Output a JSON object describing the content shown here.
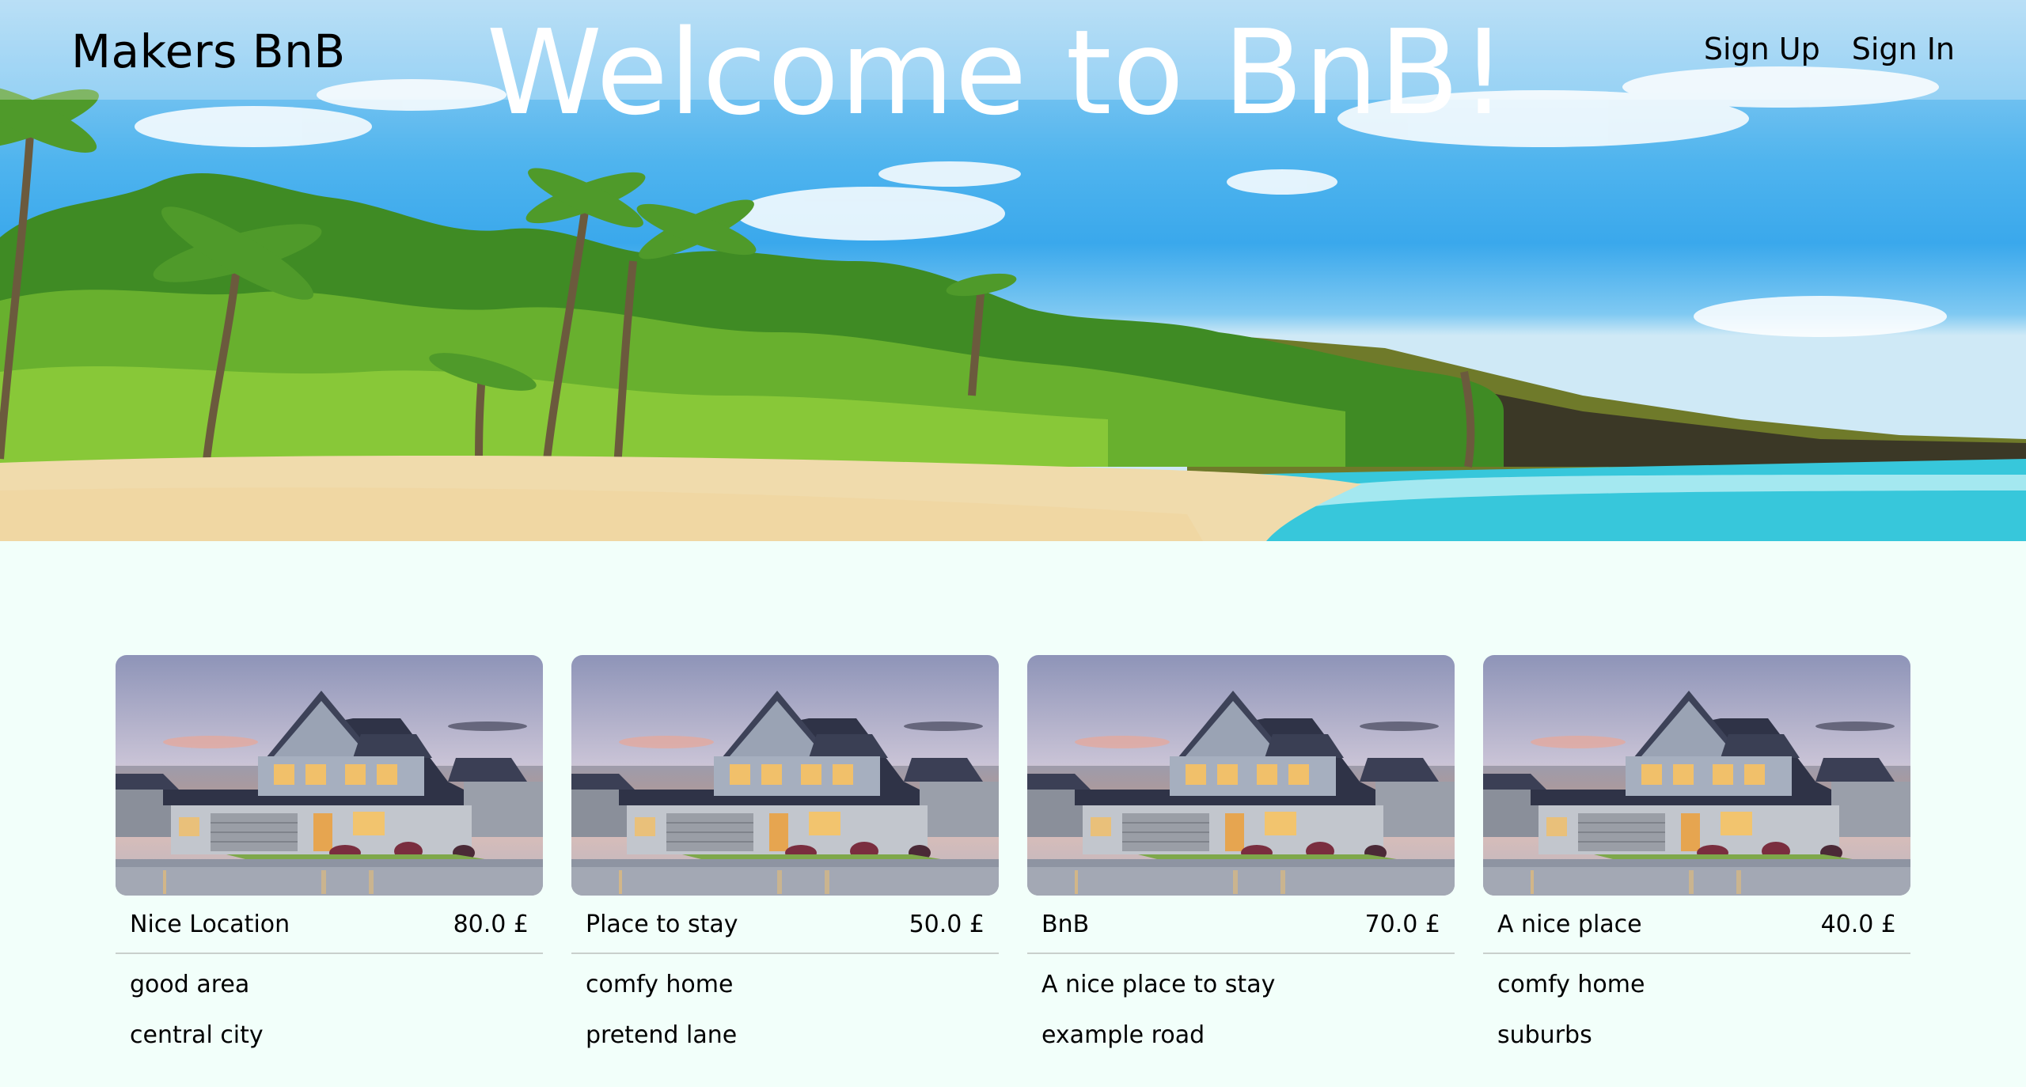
{
  "header": {
    "brand": "Makers BnB",
    "title": "Welcome to BnB!",
    "nav": {
      "sign_up": "Sign Up",
      "sign_in": "Sign In"
    }
  },
  "listings": [
    {
      "name": "Nice Location",
      "price": "80.0 £",
      "description": "good area",
      "address": "central city"
    },
    {
      "name": "Place to stay",
      "price": "50.0 £",
      "description": "comfy home",
      "address": "pretend lane"
    },
    {
      "name": "BnB",
      "price": "70.0 £",
      "description": "A nice place to stay",
      "address": "example road"
    },
    {
      "name": "A nice place",
      "price": "40.0 £",
      "description": "comfy home",
      "address": "suburbs"
    }
  ],
  "colors": {
    "page_background": "#f2fffa",
    "divider": "#c9cfcc",
    "hero_title": "#ffffff"
  }
}
